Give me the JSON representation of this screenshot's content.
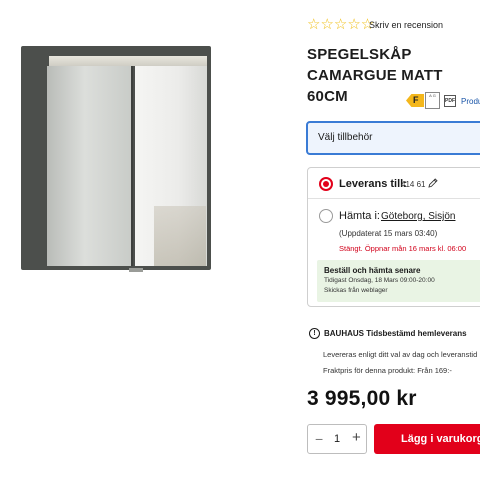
{
  "review": {
    "stars": "☆☆☆☆☆",
    "link_label": "Skriv en recension"
  },
  "product": {
    "title": "SPEGELSKÅP CAMARGUE MATT 60CM"
  },
  "energy": {
    "class": "F",
    "scale": "A G",
    "pdf_label": "PDF",
    "product_sheet_label": "Produ",
    "accent_color": "#f4b71c"
  },
  "accessory": {
    "placeholder": "Välj tillbehör"
  },
  "delivery": {
    "label": "Leverans till:",
    "postal_code": "414 61",
    "pickup_label": "Hämta i:",
    "store": "Göteborg, Sisjön",
    "updated": "(Uppdaterat 15 mars 03:40)",
    "store_status": "Stängt. Öppnar mån 16 mars kl. 06:00",
    "order_title": "Beställ och hämta senare",
    "order_earliest": "Tidigast Onsdag, 18 Mars 09:00-20:00",
    "order_source": "Skickas från weblager"
  },
  "home_delivery": {
    "info_symbol": "!",
    "title": "BAUHAUS Tidsbestämd hemleverans",
    "text": "Levereras enligt ditt val av dag och leveranstid",
    "freight": "Fraktpris för denna produkt: Från 169:-"
  },
  "price": "3 995,00 kr",
  "cart": {
    "quantity": "1",
    "minus": "−",
    "plus": "+",
    "add_label": "Lägg i varukorg"
  },
  "colors": {
    "brand_red": "#e2001a",
    "link_blue": "#1a55a8",
    "select_border": "#3a7bd5",
    "order_bg": "#e9f4e4"
  }
}
